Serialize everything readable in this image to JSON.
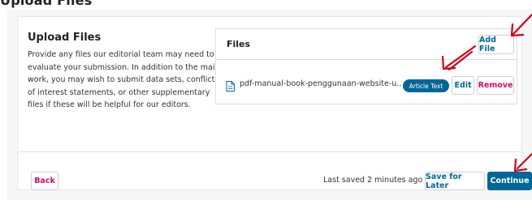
{
  "page_heading_partial": "Upload Files",
  "upload_section": {
    "title": "Upload Files",
    "description": "Provide any files our editorial team may need to evaluate your submission. In addition to the main work, you may wish to submit data sets, conflict of interest statements, or other supplementary files if these will be helpful for our editors."
  },
  "files_panel": {
    "title": "Files",
    "add_file_label": "Add File",
    "file": {
      "icon": "document-icon",
      "name": "pdf-manual-book-penggunaan-website-u...",
      "badge": "Article Text",
      "edit_label": "Edit",
      "remove_label": "Remove"
    }
  },
  "footer": {
    "back_label": "Back",
    "last_saved": "Last saved 2 minutes ago",
    "save_later_label": "Save for Later",
    "continue_label": "Continue"
  },
  "colors": {
    "primary": "#006798",
    "danger": "#d00a6c",
    "annotation": "#d0021b",
    "panel_bg": "#f7f7f7"
  }
}
